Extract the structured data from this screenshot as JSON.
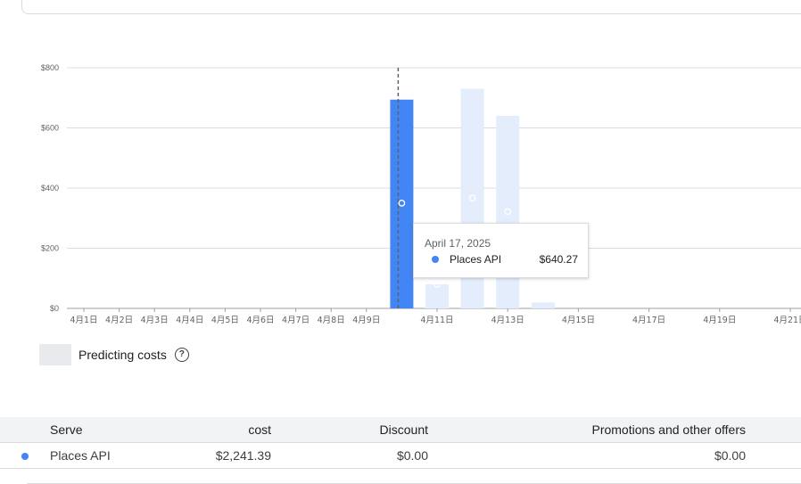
{
  "colors": {
    "actual_bar": "#4285f4",
    "forecast_bar": "#e3edfc",
    "grid": "#dadce0",
    "axis_text": "#5f6368"
  },
  "chart_data": {
    "type": "bar",
    "title": "",
    "xlabel": "",
    "ylabel": "",
    "ylim": [
      0,
      800
    ],
    "y_ticks": [
      "$0",
      "$200",
      "$400",
      "$600",
      "$800"
    ],
    "y_tick_values": [
      0,
      200,
      400,
      600,
      800
    ],
    "x_tick_labels": [
      {
        "label": "4月1日",
        "day": 1
      },
      {
        "label": "4月2日",
        "day": 2
      },
      {
        "label": "4月3日",
        "day": 3
      },
      {
        "label": "4月4日",
        "day": 4
      },
      {
        "label": "4月5日",
        "day": 5
      },
      {
        "label": "4月6日",
        "day": 6
      },
      {
        "label": "4月7日",
        "day": 7
      },
      {
        "label": "4月8日",
        "day": 8
      },
      {
        "label": "4月9日",
        "day": 9
      },
      {
        "label": "4月11日",
        "day": 11
      },
      {
        "label": "4月13日",
        "day": 13
      },
      {
        "label": "4月15日",
        "day": 15
      },
      {
        "label": "4月17日",
        "day": 17
      },
      {
        "label": "4月19日",
        "day": 19
      },
      {
        "label": "4月21日",
        "day": 21
      }
    ],
    "series": [
      {
        "name": "Places API",
        "kind": "actual",
        "points": [
          {
            "day": 10,
            "value": 694
          }
        ]
      },
      {
        "name": "Predicting costs",
        "kind": "forecast",
        "points": [
          {
            "day": 11,
            "value": 80
          },
          {
            "day": 12,
            "value": 730
          },
          {
            "day": 13,
            "value": 640
          },
          {
            "day": 14,
            "value": 20
          }
        ]
      }
    ],
    "forecast_markers": [
      {
        "day": 10,
        "value": 350
      },
      {
        "day": 11,
        "value": 80
      },
      {
        "day": 12,
        "value": 367
      },
      {
        "day": 13,
        "value": 322
      }
    ],
    "cursor_day": 10,
    "legend": "bottom-left"
  },
  "legend": {
    "label": "Predicting costs",
    "help_icon": "help-circle-icon",
    "help_glyph": "?"
  },
  "tooltip": {
    "date": "April 17, 2025",
    "series": "Places API",
    "value": "$640.27"
  },
  "table": {
    "headers": {
      "serve": "Serve",
      "cost": "cost",
      "discount": "Discount",
      "promotions": "Promotions and other offers"
    },
    "rows": [
      {
        "serve": "Places API",
        "cost": "$2,241.39",
        "discount": "$0.00",
        "promotions": "$0.00"
      }
    ]
  }
}
